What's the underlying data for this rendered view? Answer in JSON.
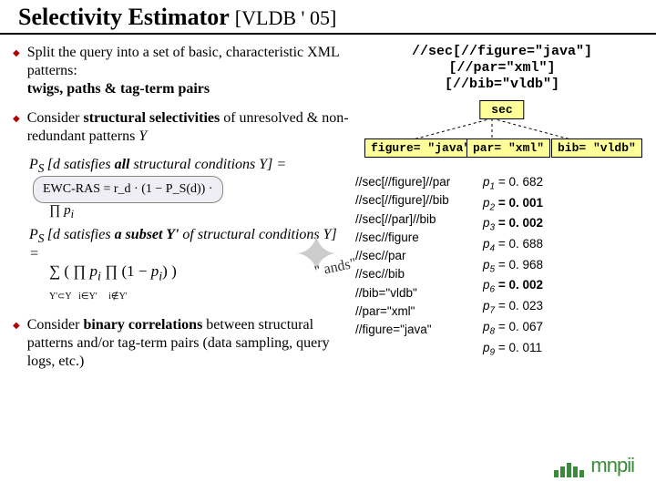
{
  "title": {
    "main": "Selectivity Estimator",
    "ref": "[VLDB ' 05]"
  },
  "bullets": {
    "b1a": "Split the query into a set of basic, characteristic XML patterns:",
    "b1b": "twigs, paths & tag-term pairs",
    "b2a": "Consider ",
    "b2b": "structural selectivities",
    "b2c": " of unresolved & non-redundant patterns ",
    "b2d": "Y",
    "ps1a": "P",
    "ps1b": "S ",
    "ps1c": "[d satisfies ",
    "ps1d": "all",
    "ps1e": " structural conditions Y] = ",
    "formula1": "EWC-RAS = r_d · (1 − P_S(d)) ·",
    "ps2a": "P",
    "ps2b": "S ",
    "ps2c": "[d satisfies ",
    "ps2d": "a subset Y'",
    "ps2e": " of structural conditions Y] = ",
    "b3a": "Consider ",
    "b3b": "binary correlations",
    "b3c": " between structural patterns and/or tag-term pairs (data sampling, query logs, etc.)"
  },
  "code": {
    "l1": "//sec[//figure=\"java\"]",
    "l2": "[//par=\"xml\"]",
    "l3": "[//bib=\"vldb\"]"
  },
  "tree": {
    "root": "sec",
    "leaf1": "figure= \"java\"",
    "leaf2": "par= \"xml\"",
    "leaf3": "bib= \"vldb\""
  },
  "paths": {
    "r1": "//sec[//figure]//par",
    "p1l": "p",
    "p1s": "1",
    "p1v": " = 0. 682",
    "r2": "//sec[//figure]//bib",
    "p2l": "p",
    "p2s": "2",
    "p2v": " = 0. 001",
    "r3": "//sec[//par]//bib",
    "p3l": "p",
    "p3s": "3",
    "p3v": " = 0. 002",
    "r4": "//sec//figure",
    "p4l": "p",
    "p4s": "4",
    "p4v": " = 0. 688",
    "r5": "//sec//par",
    "p5l": "p",
    "p5s": "5",
    "p5v": " = 0. 968",
    "r6": "//sec//bib",
    "p6l": "p",
    "p6s": "6",
    "p6v": " = 0. 002",
    "r7": "//bib=\"vldb\"",
    "p7l": "p",
    "p7s": "7",
    "p7v": " = 0. 023",
    "r8": "//par=\"xml\"",
    "p8l": "p",
    "p8s": "8",
    "p8v": " = 0. 067",
    "r9": "//figure=\"java\"",
    "p9l": "p",
    "p9s": "9",
    "p9v": " = 0. 011"
  },
  "ands": "\" ands\"",
  "logo": "mnpii"
}
